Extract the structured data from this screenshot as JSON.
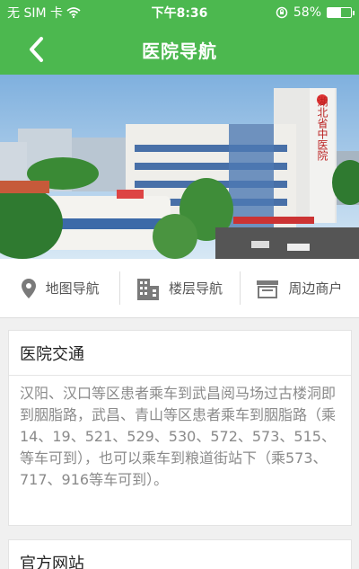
{
  "status": {
    "carrier": "无 SIM 卡",
    "time": "下午8:36",
    "battery": "58%",
    "battery_level": 0.58
  },
  "nav": {
    "title": "医院导航"
  },
  "tabs": [
    {
      "label": "地图导航",
      "icon": "map-pin-icon"
    },
    {
      "label": "楼层导航",
      "icon": "building-icon"
    },
    {
      "label": "周边商户",
      "icon": "store-icon"
    }
  ],
  "transport": {
    "title": "医院交通",
    "text": "汉阳、汉口等区患者乘车到武昌阅马场过古楼洞即到胭脂路，武昌、青山等区患者乘车到胭脂路（乘14、19、521、529、530、572、573、515、等车可到），也可以乘车到粮道街站下（乘573、717、916等车可到）。"
  },
  "website": {
    "title": "官方网站"
  },
  "colors": {
    "accent": "#4cb84f"
  }
}
